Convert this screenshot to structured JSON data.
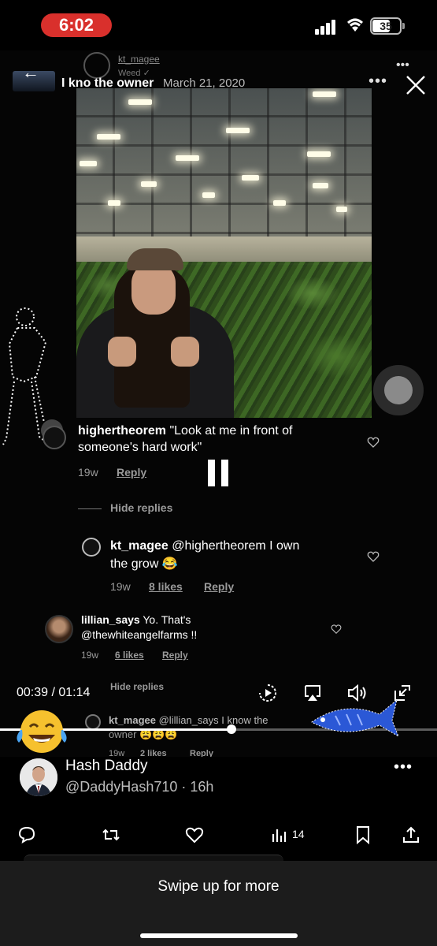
{
  "status_bar": {
    "time": "6:02",
    "battery": "35"
  },
  "recorded": {
    "top_user": "kt_magee",
    "top_sub": "Weed ✓",
    "title": "I kno the owner",
    "date": "March 21, 2020"
  },
  "comments": [
    {
      "user": "highertheorem",
      "text": "\"Look at me in front of",
      "text2": "someone's hard work\"",
      "age": "19w",
      "reply": "Reply"
    },
    {
      "user": "kt_magee",
      "text": "@highertheorem I own",
      "text2": "the grow 😂",
      "age": "19w",
      "likes": "8 likes",
      "reply": "Reply"
    },
    {
      "user": "lillian_says",
      "text": "Yo. That's",
      "text2": "@thewhiteangelfarms !!",
      "age": "19w",
      "likes": "6 likes",
      "reply": "Reply"
    },
    {
      "user": "kt_magee",
      "text": "@lillian_says I know the",
      "text2": "owner 😩😩😩",
      "age": "19w",
      "likes": "2 likes",
      "reply": "Reply"
    }
  ],
  "hide_replies": "Hide replies",
  "player": {
    "time": "00:39 / 01:14",
    "progress": 0.53
  },
  "tweet": {
    "author_name": "Hash Daddy",
    "author_handle": "@DaddyHash710 · 16h",
    "view_count": "14"
  },
  "bottom": {
    "swipe_text": "Swipe up for more"
  }
}
